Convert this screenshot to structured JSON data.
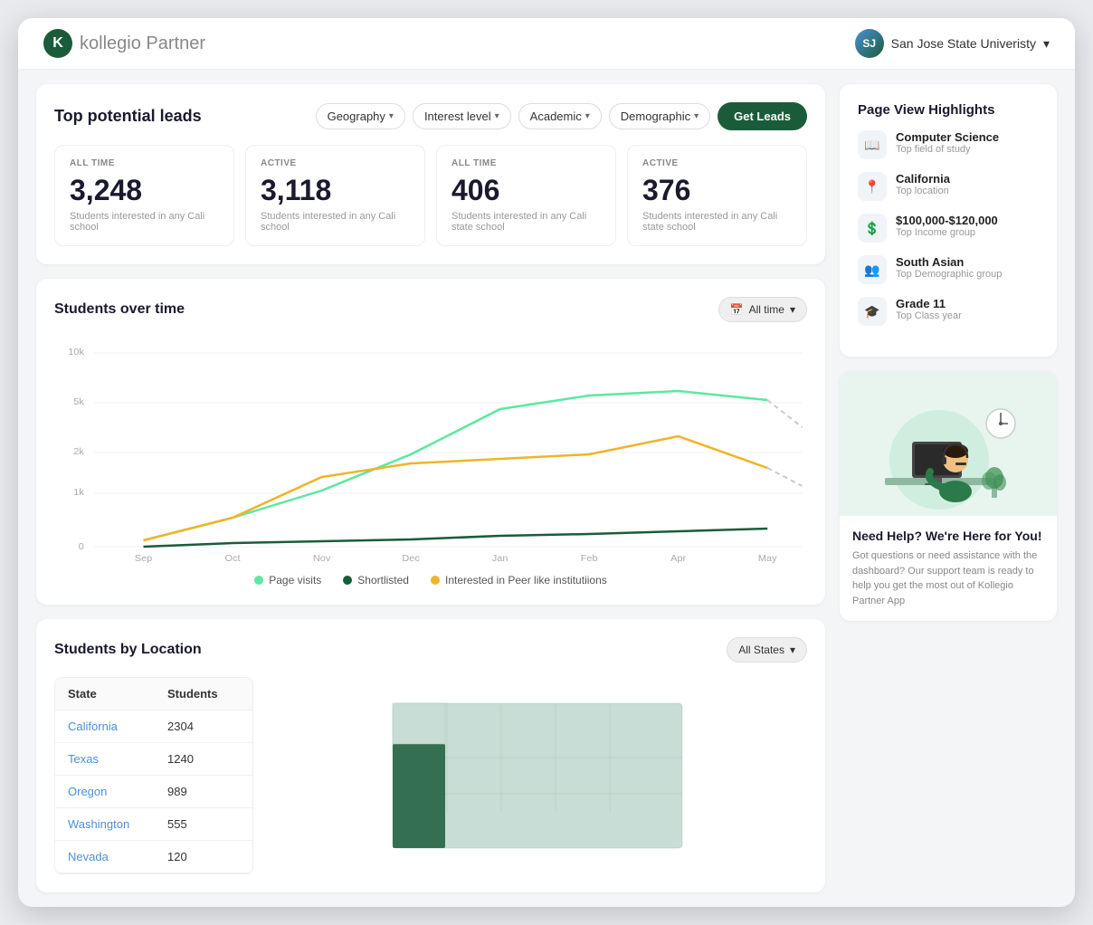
{
  "app": {
    "logo_text": "kollegio",
    "logo_partner": "Partner",
    "logo_initial": "K"
  },
  "header": {
    "university_name": "San Jose State Univeristy",
    "university_initial": "SJ"
  },
  "leads": {
    "title": "Top potential leads",
    "filters": {
      "geography": "Geography",
      "interest_level": "Interest level",
      "academic": "Academic",
      "demographic": "Demographic"
    },
    "get_leads_label": "Get Leads"
  },
  "stats": [
    {
      "badge": "ALL TIME",
      "number": "3,248",
      "description": "Students interested in any Cali school"
    },
    {
      "badge": "ACTIVE",
      "number": "3,118",
      "description": "Students interested in any Cali school"
    },
    {
      "badge": "ALL TIME",
      "number": "406",
      "description": "Students interested in any Cali  state school"
    },
    {
      "badge": "ACTIVE",
      "number": "376",
      "description": "Students interested in any Cali  state school"
    }
  ],
  "chart": {
    "title": "Students over time",
    "time_filter": "All time",
    "months": [
      "Sep",
      "Oct",
      "Nov",
      "Dec",
      "Jan",
      "Feb",
      "Apr",
      "May"
    ],
    "legend": [
      {
        "label": "Page visits",
        "color": "#5de8a0"
      },
      {
        "label": "Shortlisted",
        "color": "#1a5c3a"
      },
      {
        "label": "Interested in Peer like institutiions",
        "color": "#f0b429"
      }
    ],
    "y_labels": [
      "0",
      "1k",
      "2k",
      "5k",
      "10k"
    ]
  },
  "location": {
    "title": "Students by Location",
    "all_states_label": "All States",
    "table_headers": {
      "state": "State",
      "students": "Students"
    },
    "rows": [
      {
        "state": "California",
        "count": "2304"
      },
      {
        "state": "Texas",
        "count": "1240"
      },
      {
        "state": "Oregon",
        "count": "989"
      },
      {
        "state": "Washington",
        "count": "555"
      },
      {
        "state": "Nevada",
        "count": "120"
      }
    ]
  },
  "page_view": {
    "title": "Page View Highlights",
    "items": [
      {
        "icon": "📚",
        "main": "Computer Science",
        "sub": "Top field of study"
      },
      {
        "icon": "📍",
        "main": "California",
        "sub": "Top location"
      },
      {
        "icon": "💲",
        "main": "$100,000-$120,000",
        "sub": "Top Income group"
      },
      {
        "icon": "👥",
        "main": "South Asian",
        "sub": "Top Demographic group"
      },
      {
        "icon": "🎓",
        "main": "Grade 11",
        "sub": "Top Class year"
      }
    ]
  },
  "help": {
    "title": "Need Help? We're Here for You!",
    "description": "Got questions or need assistance with the dashboard? Our support team is ready to help you get the most out of Kollegio Partner App"
  }
}
